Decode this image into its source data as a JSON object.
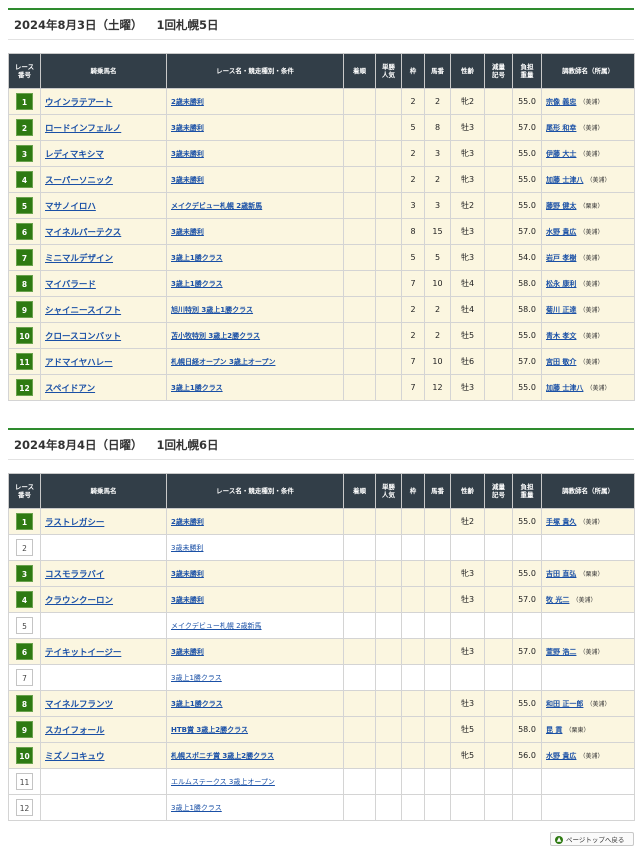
{
  "headers": [
    "レース\n番号",
    "騎乗馬名",
    "レース名・競走種別・条件",
    "着順",
    "単勝\n人気",
    "枠",
    "馬番",
    "性齢",
    "減量\n記号",
    "負担\n重量",
    "調教師名（所属）"
  ],
  "days": [
    {
      "title_date": "2024年8月3日（土曜）",
      "title_meet": "1回札幌5日",
      "rows": [
        {
          "race": "1",
          "horse": "ウインラテアート",
          "race_name": "2歳未勝利",
          "place": "",
          "pop": "",
          "waku": "2",
          "umaban": "2",
          "sexage": "牝2",
          "mark": "",
          "weight": "55.0",
          "trainer": "宗像 義忠",
          "belong": "（美浦）"
        },
        {
          "race": "2",
          "horse": "ロードインフェルノ",
          "race_name": "3歳未勝利",
          "place": "",
          "pop": "",
          "waku": "5",
          "umaban": "8",
          "sexage": "牡3",
          "mark": "",
          "weight": "57.0",
          "trainer": "尾形 和幸",
          "belong": "（美浦）"
        },
        {
          "race": "3",
          "horse": "レディマキシマ",
          "race_name": "3歳未勝利",
          "place": "",
          "pop": "",
          "waku": "2",
          "umaban": "3",
          "sexage": "牝3",
          "mark": "",
          "weight": "55.0",
          "trainer": "伊藤 大士",
          "belong": "（美浦）"
        },
        {
          "race": "4",
          "horse": "スーパーソニック",
          "race_name": "3歳未勝利",
          "place": "",
          "pop": "",
          "waku": "2",
          "umaban": "2",
          "sexage": "牝3",
          "mark": "",
          "weight": "55.0",
          "trainer": "加藤 士津八",
          "belong": "（美浦）"
        },
        {
          "race": "5",
          "horse": "マサノイロハ",
          "race_name": "メイクデビュー札幌 2歳新馬",
          "place": "",
          "pop": "",
          "waku": "3",
          "umaban": "3",
          "sexage": "牡2",
          "mark": "",
          "weight": "55.0",
          "trainer": "藤野 健太",
          "belong": "（栗東）"
        },
        {
          "race": "6",
          "horse": "マイネルパーテクス",
          "race_name": "3歳未勝利",
          "place": "",
          "pop": "",
          "waku": "8",
          "umaban": "15",
          "sexage": "牡3",
          "mark": "",
          "weight": "57.0",
          "trainer": "水野 貴広",
          "belong": "（美浦）"
        },
        {
          "race": "7",
          "horse": "ミニマルデザイン",
          "race_name": "3歳上1勝クラス",
          "place": "",
          "pop": "",
          "waku": "5",
          "umaban": "5",
          "sexage": "牝3",
          "mark": "",
          "weight": "54.0",
          "trainer": "岩戸 孝樹",
          "belong": "（美浦）"
        },
        {
          "race": "8",
          "horse": "マイバラード",
          "race_name": "3歳上1勝クラス",
          "place": "",
          "pop": "",
          "waku": "7",
          "umaban": "10",
          "sexage": "牡4",
          "mark": "",
          "weight": "58.0",
          "trainer": "松永 康利",
          "belong": "（美浦）"
        },
        {
          "race": "9",
          "horse": "シャイニースイフト",
          "race_name": "旭川特別 3歳上1勝クラス",
          "place": "",
          "pop": "",
          "waku": "2",
          "umaban": "2",
          "sexage": "牡4",
          "mark": "",
          "weight": "58.0",
          "trainer": "菊川 正達",
          "belong": "（美浦）"
        },
        {
          "race": "10",
          "horse": "クロースコンバット",
          "race_name": "苫小牧特別 3歳上2勝クラス",
          "place": "",
          "pop": "",
          "waku": "2",
          "umaban": "2",
          "sexage": "牡5",
          "mark": "",
          "weight": "55.0",
          "trainer": "青木 孝文",
          "belong": "（美浦）"
        },
        {
          "race": "11",
          "horse": "アドマイヤハレー",
          "race_name": "札幌日経オープン 3歳上オープン",
          "place": "",
          "pop": "",
          "waku": "7",
          "umaban": "10",
          "sexage": "牡6",
          "mark": "",
          "weight": "57.0",
          "trainer": "宮田 敬介",
          "belong": "（美浦）"
        },
        {
          "race": "12",
          "horse": "スペイドアン",
          "race_name": "3歳上1勝クラス",
          "place": "",
          "pop": "",
          "waku": "7",
          "umaban": "12",
          "sexage": "牡3",
          "mark": "",
          "weight": "55.0",
          "trainer": "加藤 士津八",
          "belong": "（美浦）"
        }
      ]
    },
    {
      "title_date": "2024年8月4日（日曜）",
      "title_meet": "1回札幌6日",
      "rows": [
        {
          "race": "1",
          "horse": "ラストレガシー",
          "race_name": "2歳未勝利",
          "place": "",
          "pop": "",
          "waku": "",
          "umaban": "",
          "sexage": "牡2",
          "mark": "",
          "weight": "55.0",
          "trainer": "手塚 貴久",
          "belong": "（美浦）"
        },
        {
          "race": "2",
          "horse": "",
          "race_name": "3歳未勝利",
          "place": "",
          "pop": "",
          "waku": "",
          "umaban": "",
          "sexage": "",
          "mark": "",
          "weight": "",
          "trainer": "",
          "belong": ""
        },
        {
          "race": "3",
          "horse": "コスモララバイ",
          "race_name": "3歳未勝利",
          "place": "",
          "pop": "",
          "waku": "",
          "umaban": "",
          "sexage": "牝3",
          "mark": "",
          "weight": "55.0",
          "trainer": "吉田 直弘",
          "belong": "（栗東）"
        },
        {
          "race": "4",
          "horse": "クラウンクーロン",
          "race_name": "3歳未勝利",
          "place": "",
          "pop": "",
          "waku": "",
          "umaban": "",
          "sexage": "牡3",
          "mark": "",
          "weight": "57.0",
          "trainer": "牧 光二",
          "belong": "（美浦）"
        },
        {
          "race": "5",
          "horse": "",
          "race_name": "メイクデビュー札幌 2歳新馬",
          "place": "",
          "pop": "",
          "waku": "",
          "umaban": "",
          "sexage": "",
          "mark": "",
          "weight": "",
          "trainer": "",
          "belong": ""
        },
        {
          "race": "6",
          "horse": "テイキットイージー",
          "race_name": "3歳未勝利",
          "place": "",
          "pop": "",
          "waku": "",
          "umaban": "",
          "sexage": "牡3",
          "mark": "",
          "weight": "57.0",
          "trainer": "萱野 浩二",
          "belong": "（美浦）"
        },
        {
          "race": "7",
          "horse": "",
          "race_name": "3歳上1勝クラス",
          "place": "",
          "pop": "",
          "waku": "",
          "umaban": "",
          "sexage": "",
          "mark": "",
          "weight": "",
          "trainer": "",
          "belong": ""
        },
        {
          "race": "8",
          "horse": "マイネルフランツ",
          "race_name": "3歳上1勝クラス",
          "place": "",
          "pop": "",
          "waku": "",
          "umaban": "",
          "sexage": "牡3",
          "mark": "",
          "weight": "55.0",
          "trainer": "和田 正一郎",
          "belong": "（美浦）"
        },
        {
          "race": "9",
          "horse": "スカイフォール",
          "race_name": "HTB賞 3歳上2勝クラス",
          "place": "",
          "pop": "",
          "waku": "",
          "umaban": "",
          "sexage": "牡5",
          "mark": "",
          "weight": "58.0",
          "trainer": "昆 貢",
          "belong": "（栗東）"
        },
        {
          "race": "10",
          "horse": "ミズノコキュウ",
          "race_name": "札幌スポニチ賞 3歳上2勝クラス",
          "place": "",
          "pop": "",
          "waku": "",
          "umaban": "",
          "sexage": "牝5",
          "mark": "",
          "weight": "56.0",
          "trainer": "水野 貴広",
          "belong": "（美浦）"
        },
        {
          "race": "11",
          "horse": "",
          "race_name": "エルムステークス 3歳上オープン",
          "place": "",
          "pop": "",
          "waku": "",
          "umaban": "",
          "sexage": "",
          "mark": "",
          "weight": "",
          "trainer": "",
          "belong": ""
        },
        {
          "race": "12",
          "horse": "",
          "race_name": "3歳上1勝クラス",
          "place": "",
          "pop": "",
          "waku": "",
          "umaban": "",
          "sexage": "",
          "mark": "",
          "weight": "",
          "trainer": "",
          "belong": ""
        }
      ]
    }
  ],
  "pagetop_label": "ページトップへ戻る",
  "pagetop_icon": "arrow-up-icon"
}
